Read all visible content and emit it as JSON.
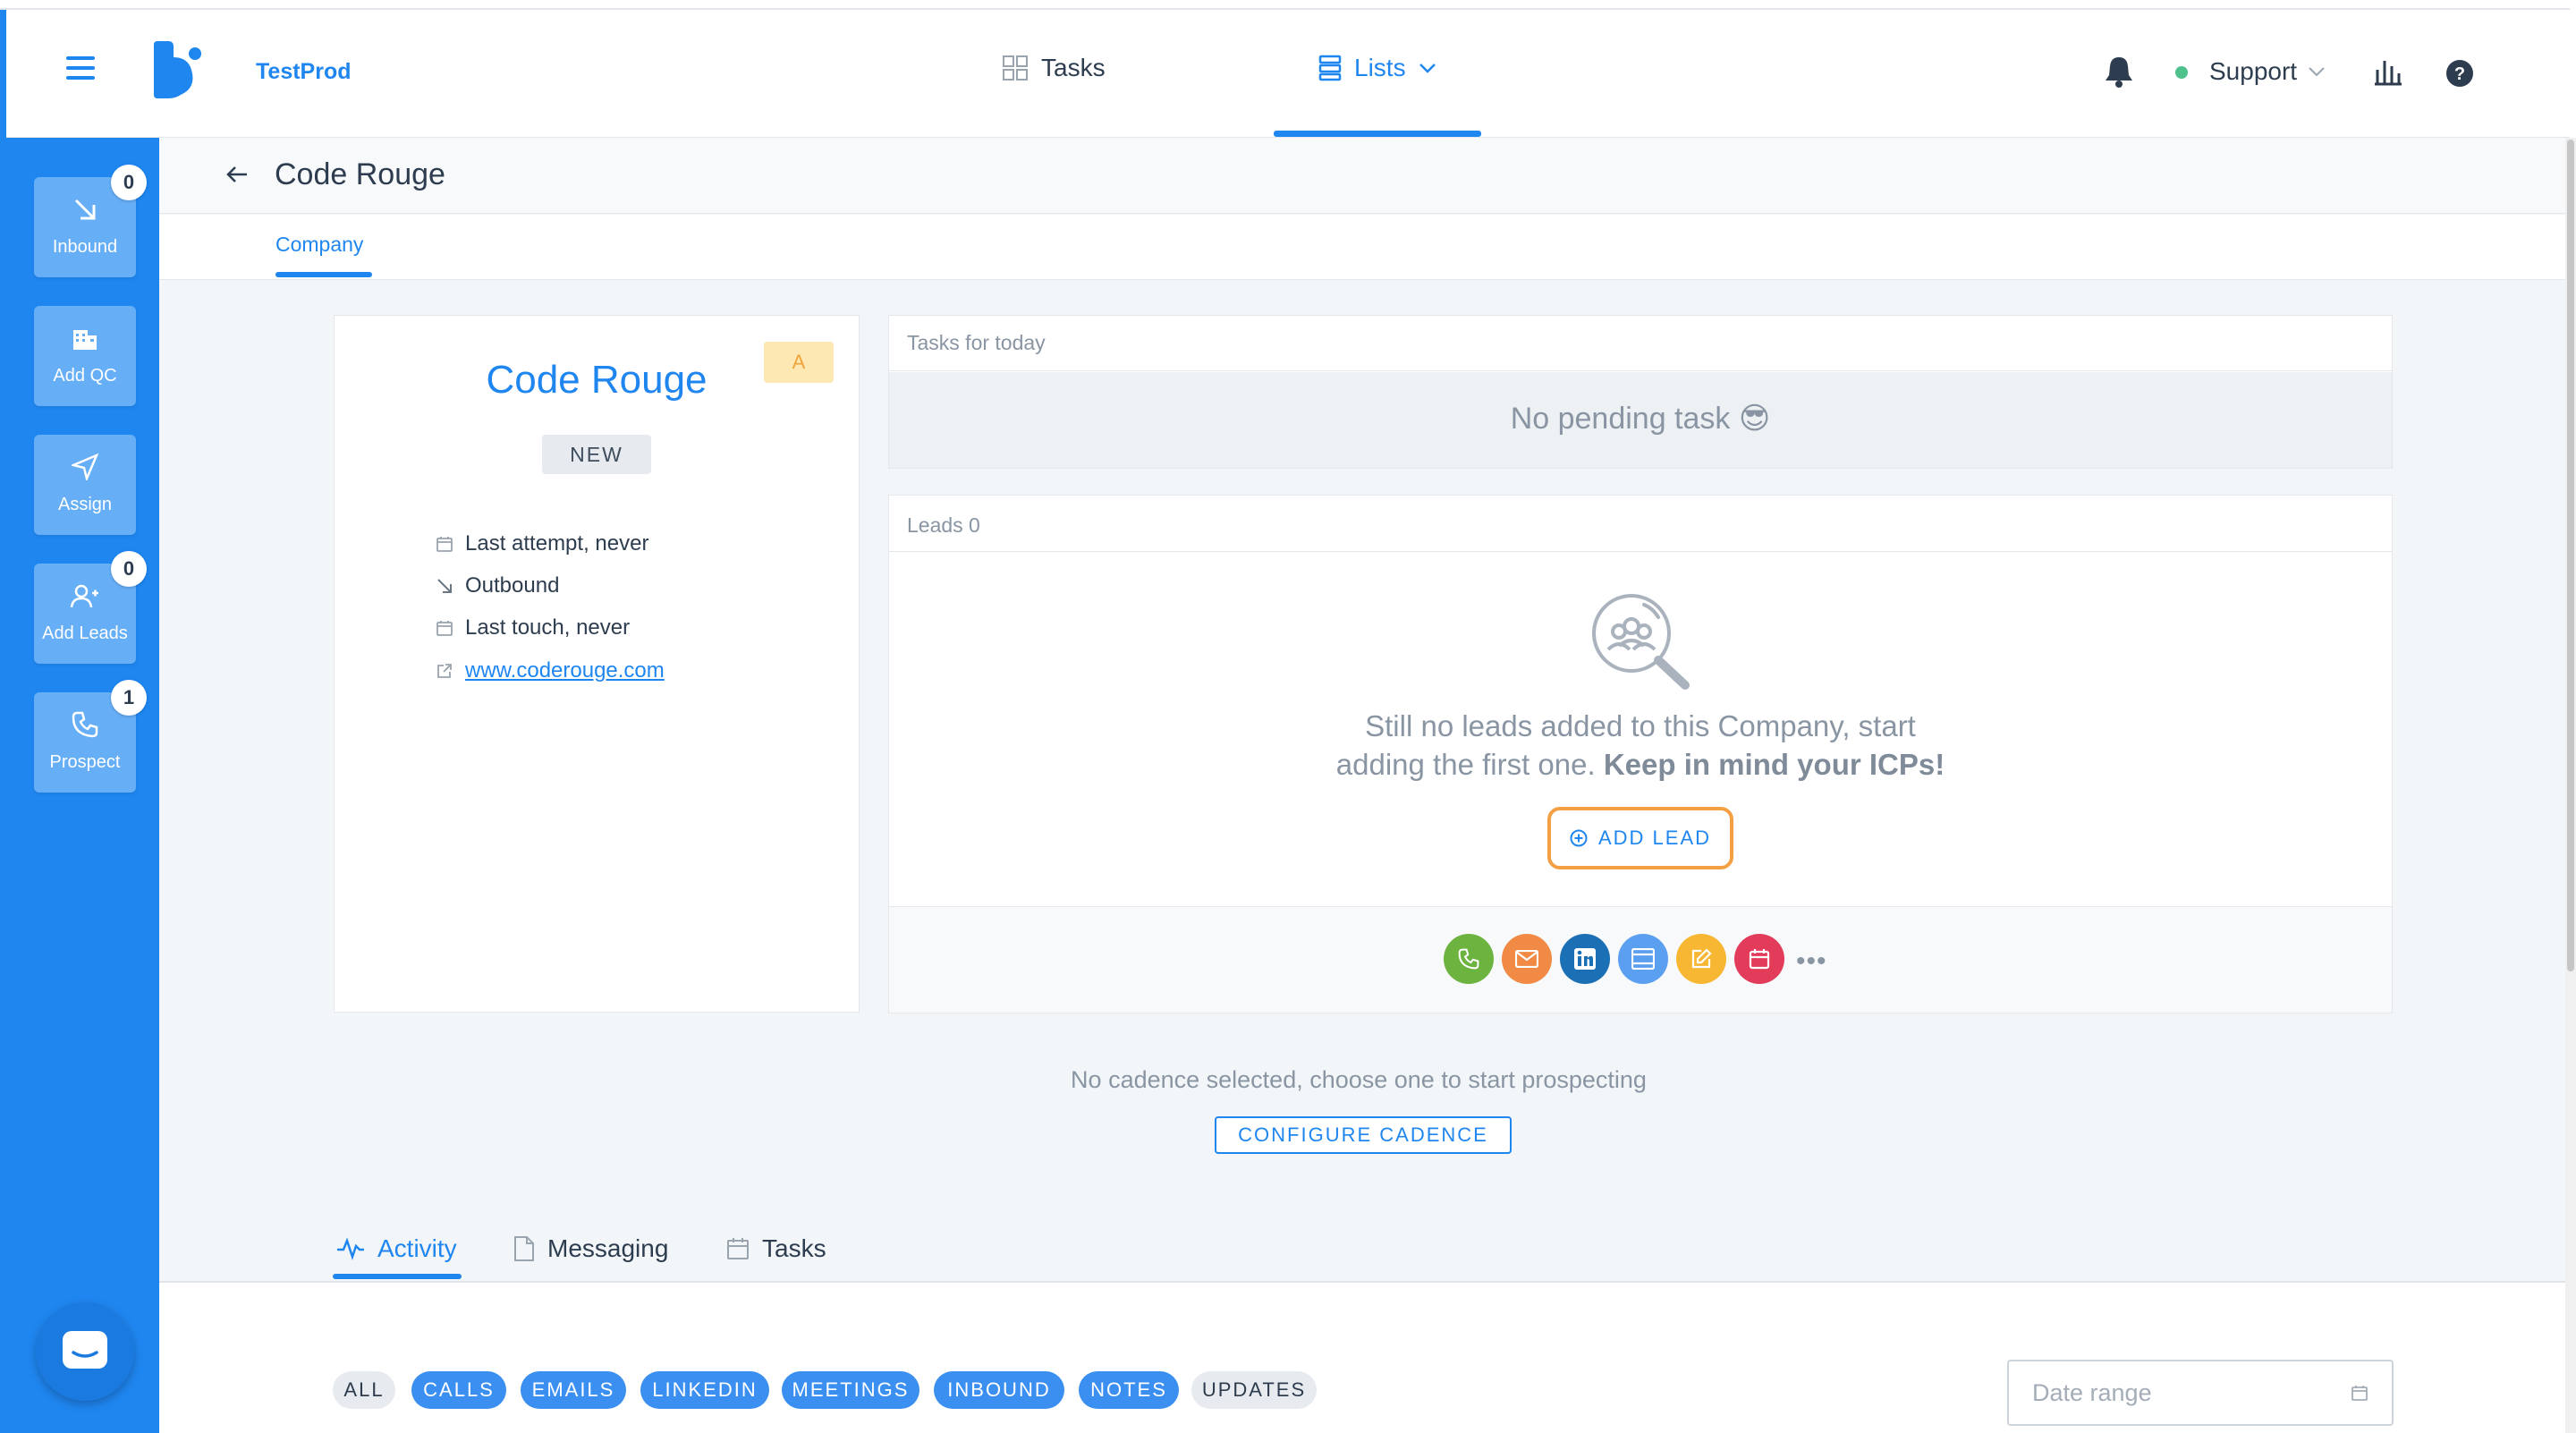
{
  "header": {
    "brand": "TestProd",
    "nav": [
      {
        "label": "Tasks",
        "icon": "grid-icon"
      },
      {
        "label": "Lists",
        "icon": "list-icon"
      }
    ],
    "user_label": "Support",
    "colors": {
      "primary": "#1f86f0",
      "online": "#4fc18c"
    }
  },
  "sidebar": {
    "items": [
      {
        "label": "Inbound",
        "icon": "arrow-down-right-icon",
        "badge": "0"
      },
      {
        "label": "Add QC",
        "icon": "building-icon",
        "badge": ""
      },
      {
        "label": "Assign",
        "icon": "send-icon",
        "badge": ""
      },
      {
        "label": "Add Leads",
        "icon": "add-user-icon",
        "badge": "0"
      },
      {
        "label": "Prospect",
        "icon": "phone-icon",
        "badge": "1"
      }
    ]
  },
  "page": {
    "title": "Code Rouge",
    "subtab": "Company"
  },
  "company": {
    "name": "Code Rouge",
    "score": "A",
    "status": "NEW",
    "last_attempt": "Last attempt, never",
    "source": "Outbound",
    "last_touch": "Last touch, never",
    "website": "www.coderouge.com"
  },
  "tasks": {
    "header": "Tasks for today",
    "empty": "No pending task 😎"
  },
  "leads": {
    "header": "Leads 0",
    "empty_line1": "Still no leads added to this Company, start",
    "empty_line2": "adding the first one.",
    "empty_bold": "Keep in mind your ICPs!",
    "add_button": "ADD LEAD",
    "actions": [
      {
        "name": "call",
        "color": "#6cb33f"
      },
      {
        "name": "email",
        "color": "#f08a44"
      },
      {
        "name": "linkedin",
        "color": "#1a6fb5"
      },
      {
        "name": "meeting",
        "color": "#5b9ff0"
      },
      {
        "name": "note",
        "color": "#f7b733"
      },
      {
        "name": "task",
        "color": "#e33b5a"
      }
    ],
    "more": "•••"
  },
  "cadence": {
    "message": "No cadence selected, choose one to start prospecting",
    "button": "CONFIGURE CADENCE"
  },
  "bottom_tabs": [
    {
      "label": "Activity",
      "icon": "activity-icon",
      "active": true
    },
    {
      "label": "Messaging",
      "icon": "document-icon",
      "active": false
    },
    {
      "label": "Tasks",
      "icon": "calendar-icon",
      "active": false
    }
  ],
  "filters": [
    "ALL",
    "CALLS",
    "EMAILS",
    "LINKEDIN",
    "MEETINGS",
    "INBOUND",
    "NOTES",
    "UPDATES"
  ],
  "date_range": {
    "placeholder": "Date range"
  }
}
